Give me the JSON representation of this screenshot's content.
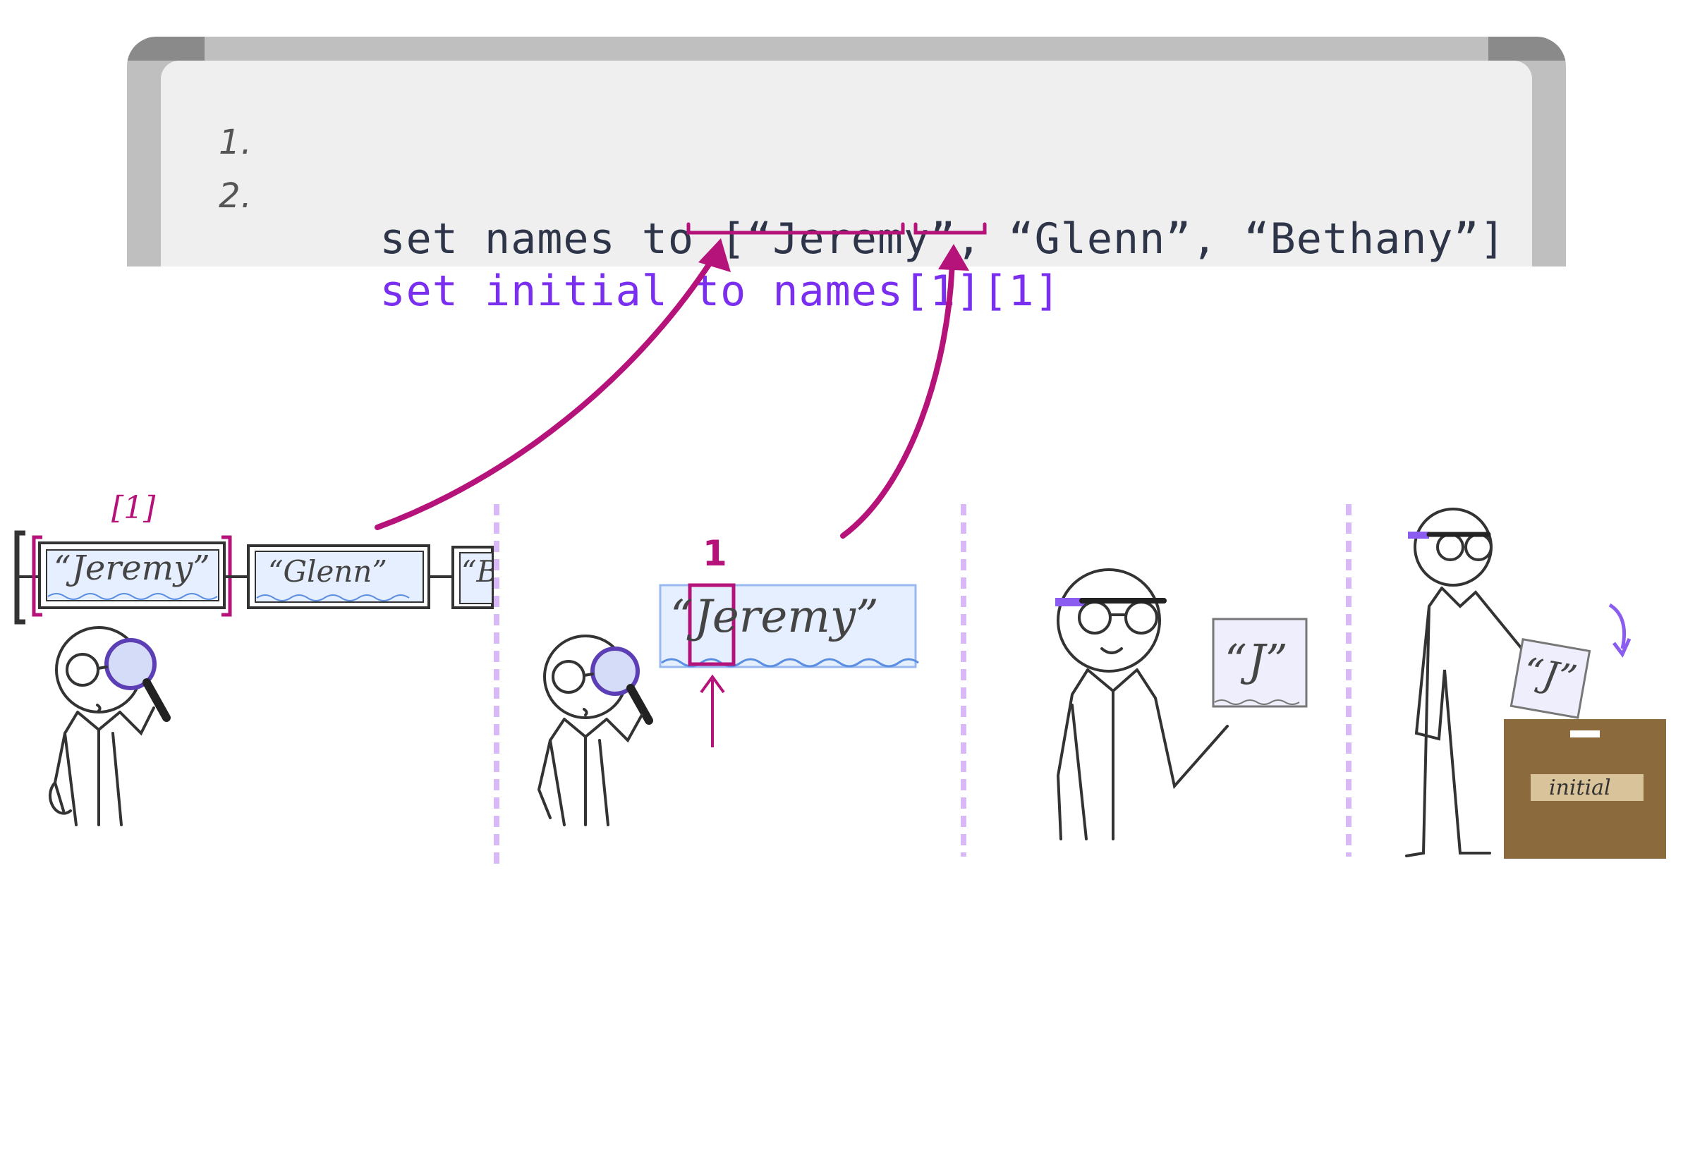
{
  "code": {
    "line1": {
      "number": "1.",
      "text": "set names to [“Jeremy”, “Glenn”, “Bethany”]"
    },
    "line2": {
      "number": "2.",
      "text": "set initial to names[1][1]"
    }
  },
  "panel1": {
    "index_label": "[1]",
    "items": [
      "“Jeremy”",
      "“Glenn”",
      "“B"
    ]
  },
  "panel2": {
    "index_label": "1",
    "string": "“Jeremy”",
    "first_char": "J",
    "rest": "eremy"
  },
  "panel3": {
    "paper_text": "“J”"
  },
  "panel4": {
    "paper_text": "“J”",
    "box_label": "initial"
  },
  "colors": {
    "magenta": "#b5127a",
    "purple_code": "#7a2ff0",
    "dark_code": "#2e3548",
    "divider": "#d8b8f5",
    "string_fill": "#e6efff",
    "box_brown": "#8b6a3e",
    "label_tan": "#d9c39a"
  }
}
